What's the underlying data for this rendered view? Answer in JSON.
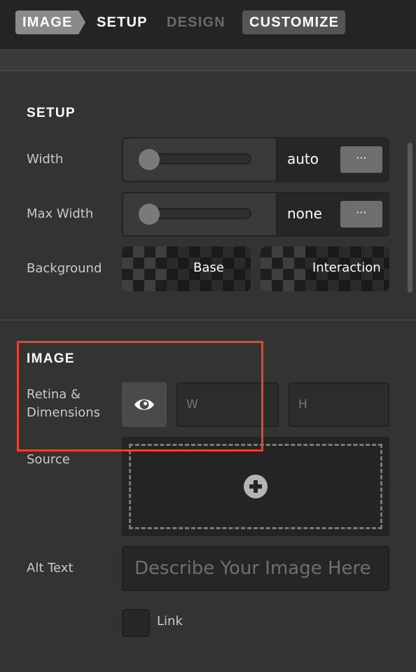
{
  "breadcrumb": {
    "items": [
      "IMAGE",
      "SETUP",
      "DESIGN",
      "CUSTOMIZE"
    ]
  },
  "setup": {
    "title": "SETUP",
    "width": {
      "label": "Width",
      "value": "auto",
      "more": "···",
      "slider_level": 0
    },
    "max_width": {
      "label": "Max Width",
      "value": "none",
      "more": "···",
      "slider_level": 0
    },
    "background": {
      "label": "Background",
      "base": "Base",
      "interaction": "Interaction"
    }
  },
  "image": {
    "title": "IMAGE",
    "retina_label": "Retina & Dimensions",
    "w_placeholder": "W",
    "h_placeholder": "H",
    "source_label": "Source",
    "alt_label": "Alt Text",
    "alt_placeholder": "Describe Your Image Here",
    "link_label": "Link",
    "link_checked": false
  },
  "colors": {
    "highlight": "#e8442a",
    "panel_bg": "#333333",
    "nav_bg": "#242424"
  },
  "icons": {
    "retina_toggle": "eye-icon",
    "source_add": "plus-circle-icon",
    "more": "ellipsis-icon"
  }
}
